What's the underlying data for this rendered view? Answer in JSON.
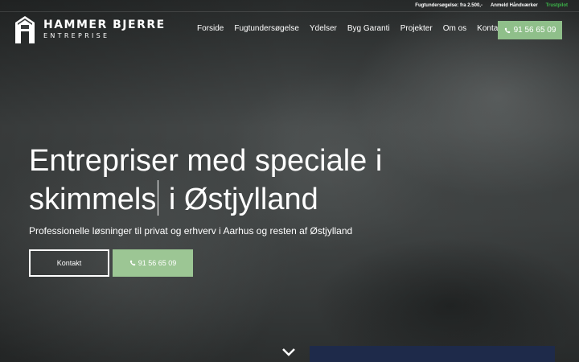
{
  "topbar": {
    "offer": "Fugtundersøgelse: fra 2.500,-",
    "review": "Anmeld Håndværker",
    "green_link": "Trustpilot"
  },
  "logo": {
    "name": "HAMMER BJERRE",
    "subtitle": "ENTREPRISE"
  },
  "nav": {
    "items": [
      "Forside",
      "Fugtundersøgelse",
      "Ydelser",
      "Byg Garanti",
      "Projekter",
      "Om os",
      "Kontakt"
    ],
    "phone": "91 56 65 09"
  },
  "hero": {
    "headline_line1": "Entrepriser med speciale i",
    "headline_line2a": "skimmels",
    "headline_line2b": "i Østjylland",
    "subtitle": "Professionelle løsninger til privat og erhverv i Aarhus og resten af Østjylland",
    "contact_button": "Kontakt",
    "phone_button": "91 56 65 09"
  },
  "colors": {
    "accent_green": "#9cc694",
    "bottom_panel": "#1e2a4a"
  },
  "icons": {
    "phone": "phone-icon",
    "scroll": "chevron-down-icon"
  }
}
